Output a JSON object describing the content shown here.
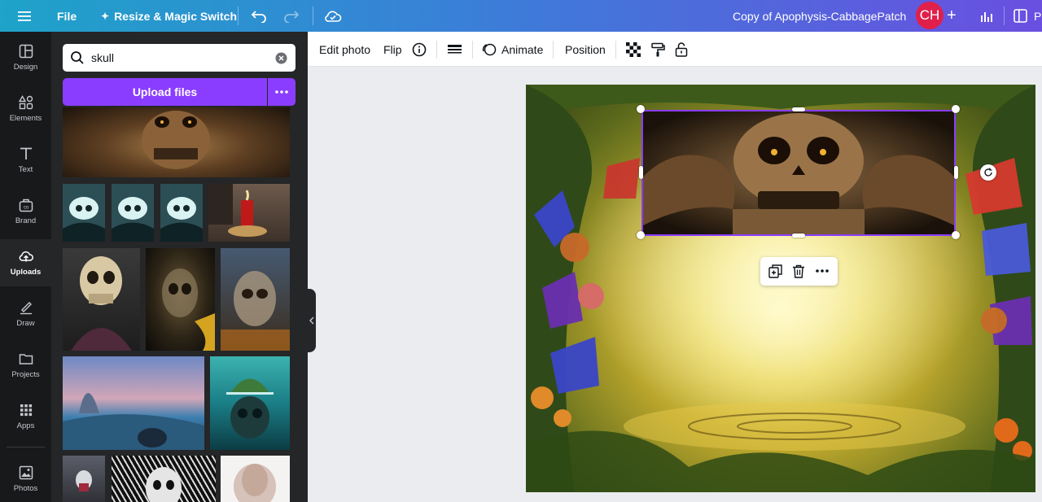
{
  "topbar": {
    "menu_icon": "hamburger-icon",
    "file_label": "File",
    "resize_label": "Resize & Magic Switch",
    "doc_title": "Copy of Apophysis-CabbagePatch",
    "avatar_initials": "CH",
    "share_label_partial": "P",
    "colors": {
      "gradient_start": "#1ea3c9",
      "gradient_end": "#6a4fe0",
      "avatar": "#e0204a"
    }
  },
  "rail": {
    "items": [
      {
        "label": "Design",
        "icon": "design-icon"
      },
      {
        "label": "Elements",
        "icon": "elements-icon"
      },
      {
        "label": "Text",
        "icon": "text-icon"
      },
      {
        "label": "Brand",
        "icon": "brand-icon"
      },
      {
        "label": "Uploads",
        "icon": "upload-cloud-icon",
        "active": true
      },
      {
        "label": "Draw",
        "icon": "draw-icon"
      },
      {
        "label": "Projects",
        "icon": "folder-icon"
      },
      {
        "label": "Apps",
        "icon": "apps-grid-icon"
      },
      {
        "label": "Photos",
        "icon": "photo-icon"
      }
    ]
  },
  "panel": {
    "search_value": "skull",
    "upload_label": "Upload files",
    "accent": "#8b3dff"
  },
  "toolbar": {
    "edit_photo": "Edit photo",
    "flip": "Flip",
    "animate": "Animate",
    "position": "Position"
  }
}
